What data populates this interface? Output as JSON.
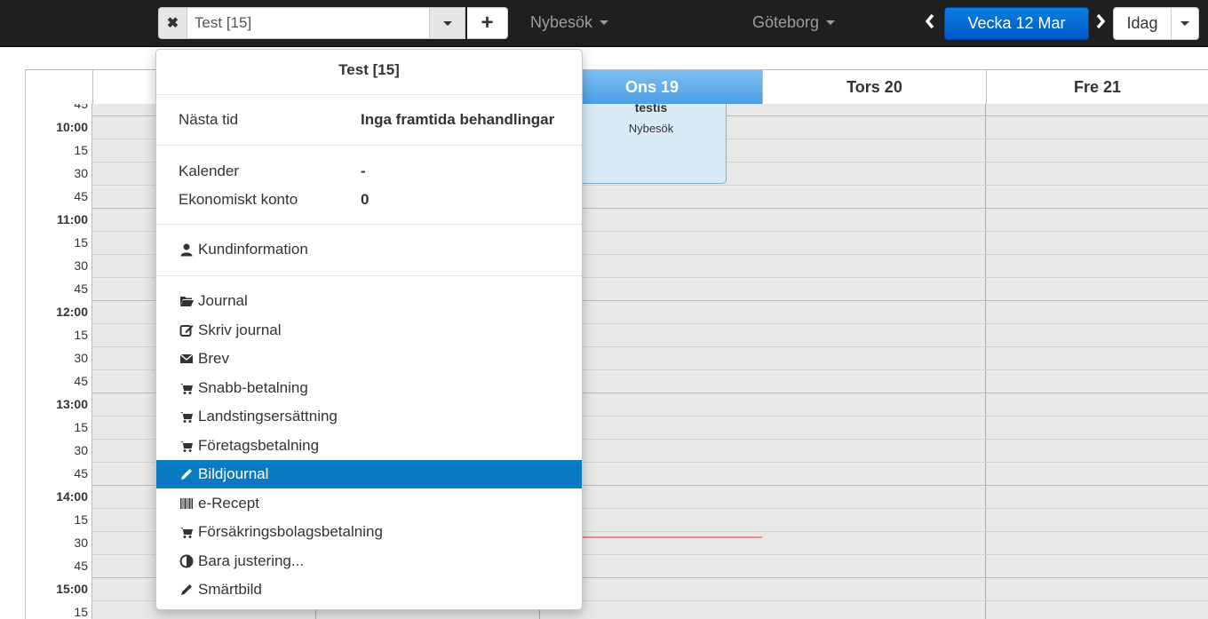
{
  "topbar": {
    "patient_value": "Test [15]",
    "visit_type": "Nybesök",
    "location": "Göteborg",
    "week_label": "Vecka 12 Mar",
    "today_label": "Idag"
  },
  "calendar": {
    "days": [
      {
        "label": ""
      },
      {
        "label": ""
      },
      {
        "label": "Ons 19"
      },
      {
        "label": "Tors 20"
      },
      {
        "label": "Fre 21"
      }
    ],
    "time_labels": [
      "45",
      "10:00",
      "15",
      "30",
      "45",
      "11:00",
      "15",
      "30",
      "45",
      "12:00",
      "15",
      "30",
      "45",
      "13:00",
      "15",
      "30",
      "45",
      "14:00",
      "15",
      "30",
      "45",
      "15:00",
      "15"
    ],
    "appointment": {
      "title": "testis",
      "type": "Nybesök"
    }
  },
  "panel": {
    "title": "Test [15]",
    "next_label": "Nästa tid",
    "next_value": "Inga framtida behandlingar",
    "calendar_label": "Kalender",
    "calendar_value": "-",
    "account_label": "Ekonomiskt konto",
    "account_value": "0",
    "customer_info": "Kundinformation",
    "menu": [
      {
        "label": "Journal",
        "icon": "folder-open-icon"
      },
      {
        "label": "Skriv journal",
        "icon": "edit-icon"
      },
      {
        "label": "Brev",
        "icon": "envelope-icon"
      },
      {
        "label": "Snabb-betalning",
        "icon": "cart-icon"
      },
      {
        "label": "Landstingsersättning",
        "icon": "cart-icon"
      },
      {
        "label": "Företagsbetalning",
        "icon": "cart-icon"
      },
      {
        "label": "Bildjournal",
        "icon": "pencil-icon",
        "active": true
      },
      {
        "label": "e-Recept",
        "icon": "barcode-icon"
      },
      {
        "label": "Försäkringsbolagsbetalning",
        "icon": "cart-icon"
      },
      {
        "label": "Bara justering...",
        "icon": "adjust-icon"
      },
      {
        "label": "Smärtbild",
        "icon": "pencil-icon"
      }
    ]
  },
  "colors": {
    "accent": "#0a7bc2",
    "topbar": "#1f1f1f",
    "week_button": "#0057c6"
  }
}
